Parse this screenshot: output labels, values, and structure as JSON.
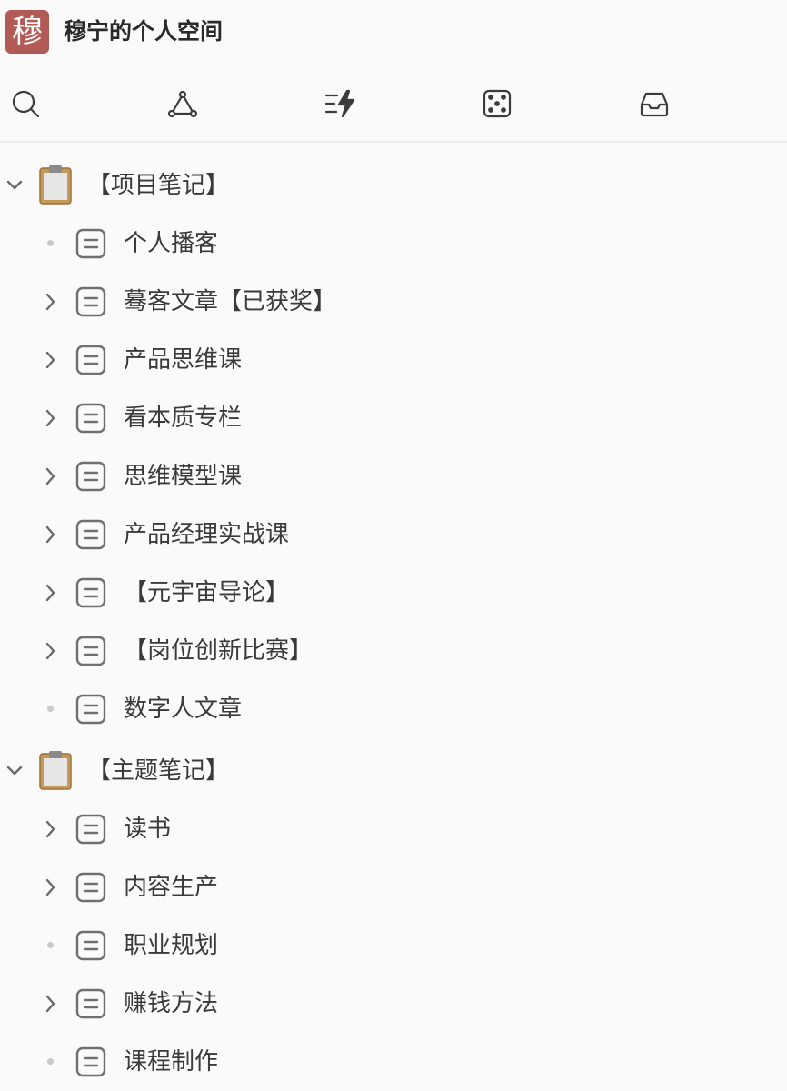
{
  "header": {
    "avatar_char": "穆",
    "title": "穆宁的个人空间"
  },
  "toolbar": {
    "icons": [
      "search-icon",
      "graph-icon",
      "quick-capture-icon",
      "random-dice-icon",
      "inbox-icon"
    ]
  },
  "tree": {
    "sections": [
      {
        "label": "【项目笔记】",
        "expanded": true,
        "items": [
          {
            "label": "个人播客",
            "has_children": false
          },
          {
            "label": "蓦客文章【已获奖】",
            "has_children": true
          },
          {
            "label": "产品思维课",
            "has_children": true
          },
          {
            "label": "看本质专栏",
            "has_children": true
          },
          {
            "label": "思维模型课",
            "has_children": true
          },
          {
            "label": "产品经理实战课",
            "has_children": true
          },
          {
            "label": "【元宇宙导论】",
            "has_children": true
          },
          {
            "label": "【岗位创新比赛】",
            "has_children": true
          },
          {
            "label": "数字人文章",
            "has_children": false
          }
        ]
      },
      {
        "label": "【主题笔记】",
        "expanded": true,
        "items": [
          {
            "label": "读书",
            "has_children": true
          },
          {
            "label": "内容生产",
            "has_children": true
          },
          {
            "label": "职业规划",
            "has_children": false
          },
          {
            "label": "赚钱方法",
            "has_children": true
          },
          {
            "label": "课程制作",
            "has_children": false
          }
        ]
      }
    ]
  },
  "colors": {
    "avatar_bg": "#b25a55",
    "background": "#fafafa",
    "text": "#3a3a3a"
  }
}
